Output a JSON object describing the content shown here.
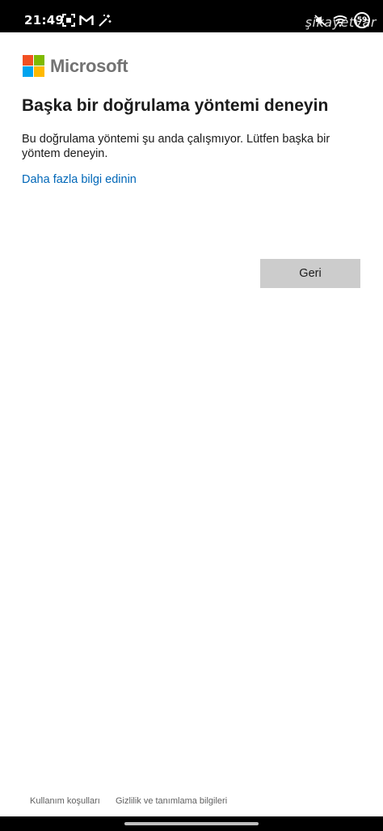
{
  "status_bar": {
    "time": "21:49",
    "battery_level": "59",
    "watermark": "şikayetvar",
    "left_icons": [
      "screenshot-icon",
      "gmail-icon",
      "magic-wand-icon"
    ],
    "right_icons": [
      "mute-icon",
      "wifi-icon",
      "battery-icon"
    ]
  },
  "brand": {
    "name": "Microsoft",
    "logo_colors": [
      "#f25022",
      "#7fba00",
      "#00a4ef",
      "#ffb900"
    ]
  },
  "page": {
    "title": "Başka bir doğrulama yöntemi deneyin",
    "description": "Bu doğrulama yöntemi şu anda çalışmıyor. Lütfen başka bir yöntem deneyin.",
    "learn_more_link": "Daha fazla bilgi edinin",
    "back_button": "Geri"
  },
  "footer": {
    "terms": "Kullanım koşulları",
    "privacy": "Gizlilik ve tanımlama bilgileri"
  },
  "colors": {
    "link": "#0067b8",
    "button_bg": "#cccccc",
    "text": "#1b1b1b",
    "footer_text": "#616161"
  }
}
